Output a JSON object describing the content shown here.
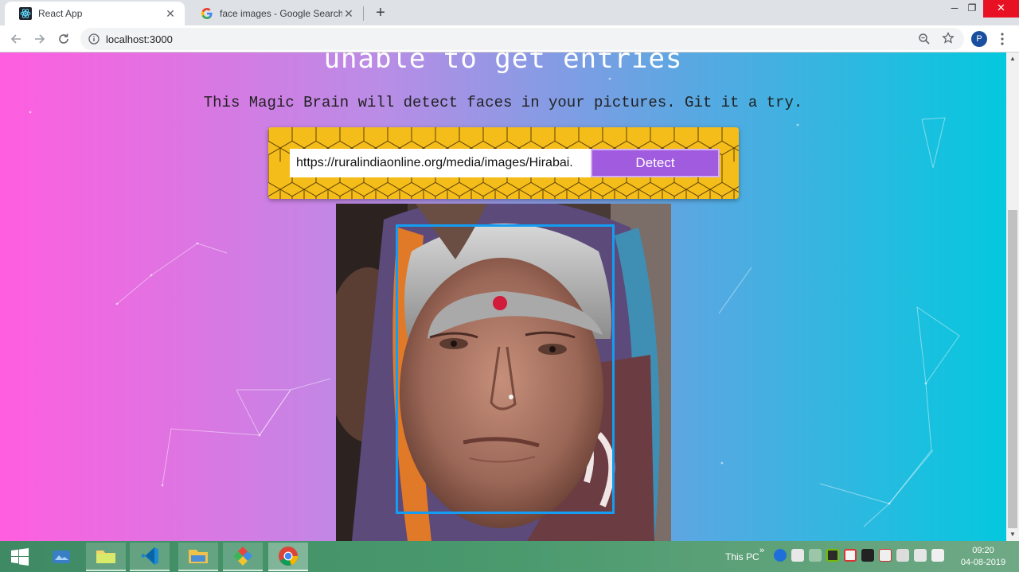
{
  "browser": {
    "tabs": [
      {
        "title": "React App",
        "favicon": "react-favicon",
        "active": true
      },
      {
        "title": "face images - Google Search",
        "favicon": "google-favicon",
        "active": false
      }
    ],
    "new_tab_label": "+",
    "window_controls": {
      "minimize": "─",
      "maximize": "❐",
      "close": "✕"
    },
    "address": "localhost:3000",
    "profile_initial": "P"
  },
  "page": {
    "headline": "unable to get entries",
    "subtitle": "This Magic Brain will detect faces in your pictures. Git it a try.",
    "image_url_value": "https://ruralindiaonline.org/media/images/Hirabai.",
    "detect_label": "Detect",
    "accent_colors": {
      "button": "#a05bdf",
      "box_border": "#149df2",
      "form_bg": "#f5bd1a"
    }
  },
  "taskbar": {
    "apps": [
      "windows-start",
      "explorer-shortcut",
      "folder-app",
      "vscode",
      "file-explorer",
      "colorful-app",
      "chrome"
    ],
    "tray_label": "This PC",
    "tray_chevron": "»",
    "time": "09:20",
    "date": "04-08-2019"
  }
}
